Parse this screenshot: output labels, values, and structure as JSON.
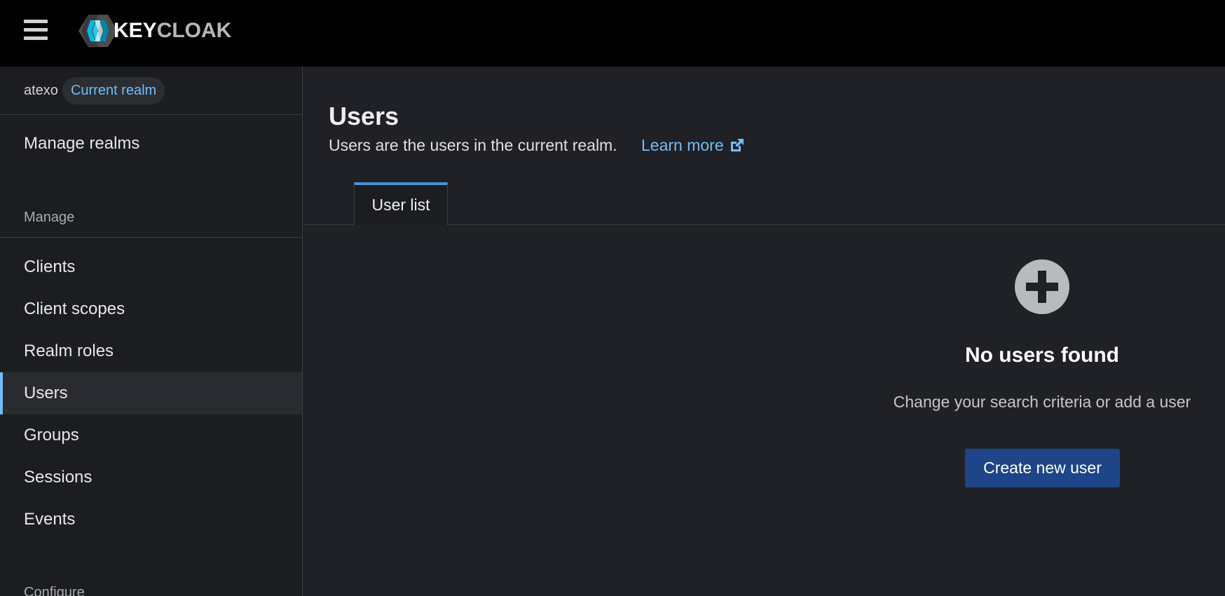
{
  "header": {
    "brand_primary": "KEYCLOAK",
    "menu_icon": "hamburger-icon",
    "logo_icon": "keycloak-logo-icon"
  },
  "sidebar": {
    "realm": {
      "name": "atexo",
      "badge": "Current realm"
    },
    "manage_realms": "Manage realms",
    "sections": [
      {
        "label": "Manage"
      },
      {
        "label": "Configure"
      }
    ],
    "items": [
      {
        "label": "Clients"
      },
      {
        "label": "Client scopes"
      },
      {
        "label": "Realm roles"
      },
      {
        "label": "Users",
        "active": true
      },
      {
        "label": "Groups"
      },
      {
        "label": "Sessions"
      },
      {
        "label": "Events"
      }
    ]
  },
  "main": {
    "title": "Users",
    "description": "Users are the users in the current realm.",
    "learn_more": "Learn more",
    "learn_more_icon": "external-link-icon",
    "tabs": [
      {
        "label": "User list",
        "active": true
      }
    ],
    "empty_state": {
      "icon": "plus-circle-icon",
      "title": "No users found",
      "body": "Change your search criteria or add a user",
      "button": "Create new user"
    }
  },
  "colors": {
    "accent": "#73bcf7",
    "primary_button": "#1e4587",
    "header_bg": "#000000",
    "sidebar_bg": "#1b1d21",
    "main_bg": "#1f2126"
  }
}
